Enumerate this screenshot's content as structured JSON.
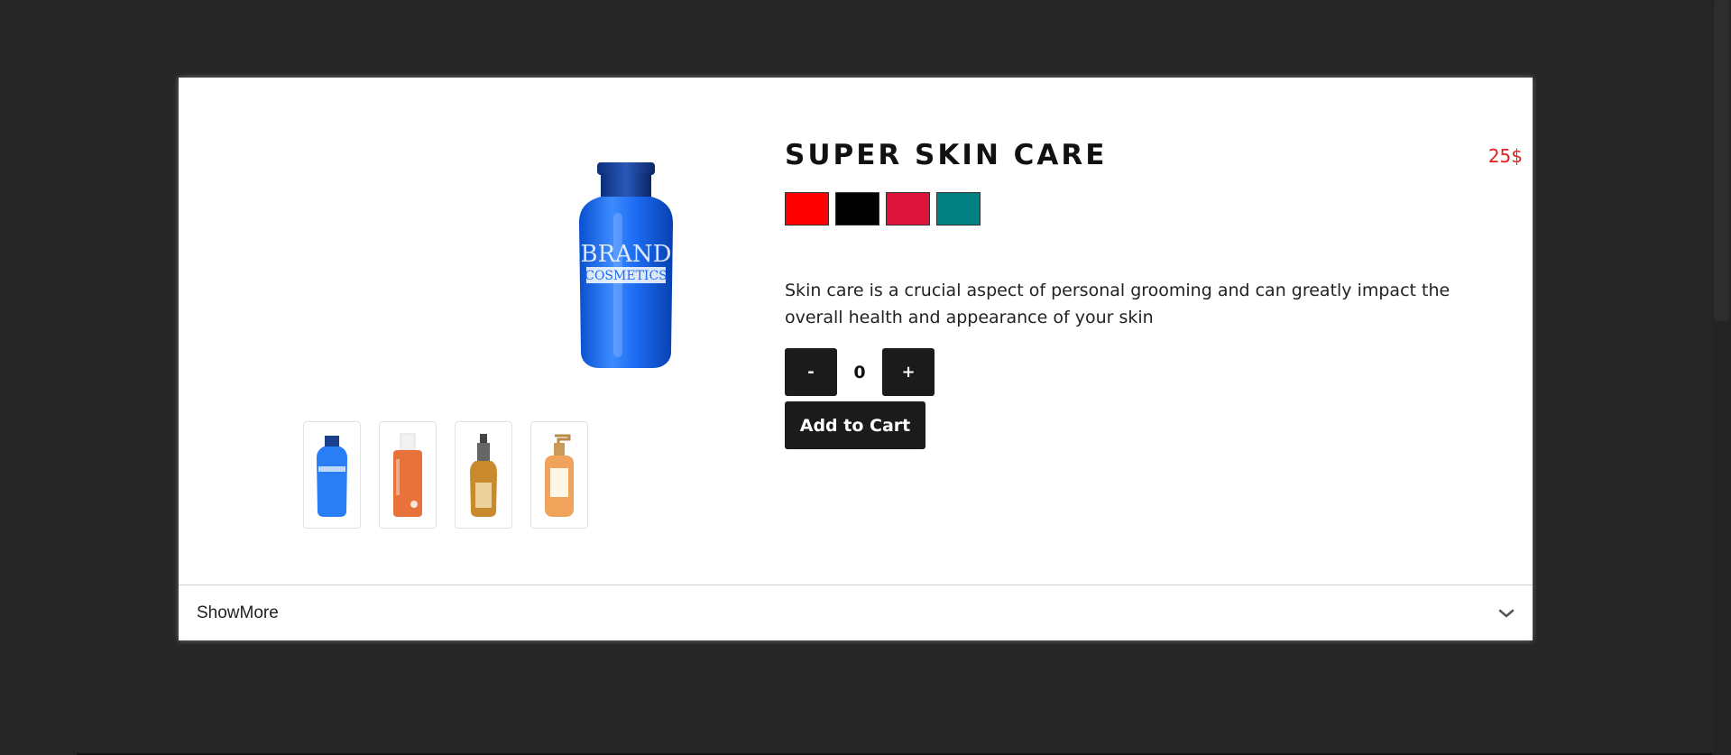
{
  "product": {
    "title": "SUPER SKIN CARE",
    "price": "25$",
    "description": "Skin care is a crucial aspect of personal grooming and can greatly impact the overall health and appearance of your skin",
    "main_image_text": {
      "line1": "BRAND",
      "line2": "COSMETICS"
    }
  },
  "colors": [
    "#ff0000",
    "#000000",
    "#dc143c",
    "#008080"
  ],
  "thumbnails": [
    {
      "name": "thumb-blue-bottle",
      "color": "#1e6fe0"
    },
    {
      "name": "thumb-orange-bottle",
      "color": "#e8733a"
    },
    {
      "name": "thumb-amber-spray",
      "color": "#c98a2e"
    },
    {
      "name": "thumb-peach-pump",
      "color": "#f0a35a"
    }
  ],
  "quantity": {
    "minus_label": "-",
    "plus_label": "+",
    "value": "0"
  },
  "cart": {
    "add_label": "Add to Cart"
  },
  "showmore": {
    "label": "ShowMore"
  }
}
